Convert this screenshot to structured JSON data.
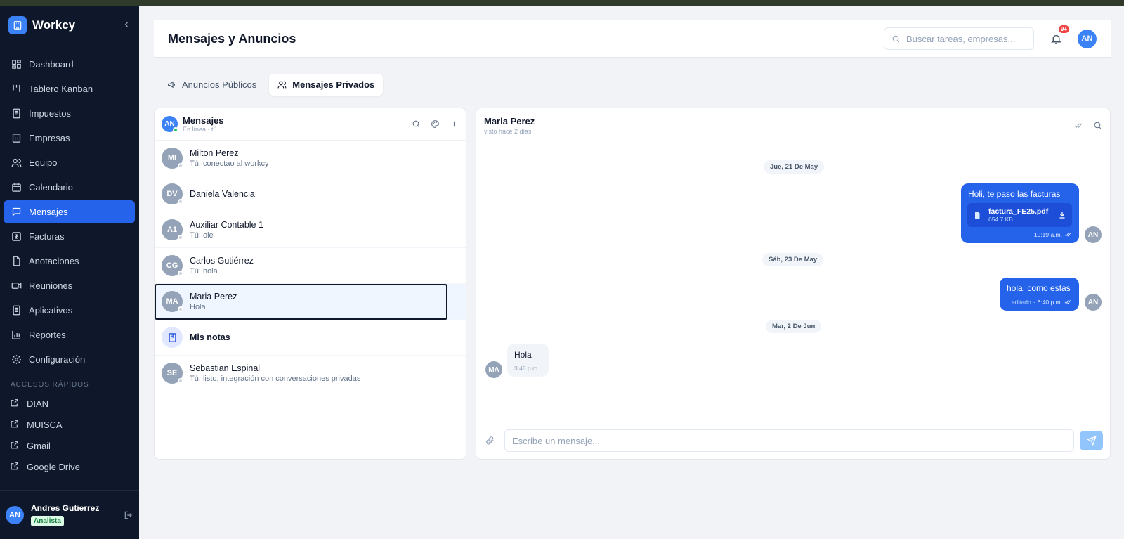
{
  "app": {
    "name": "Workcy"
  },
  "sidebar": {
    "items": [
      {
        "label": "Dashboard",
        "icon": "dashboard-icon"
      },
      {
        "label": "Tablero Kanban",
        "icon": "kanban-icon"
      },
      {
        "label": "Impuestos",
        "icon": "receipt-icon"
      },
      {
        "label": "Empresas",
        "icon": "building-icon"
      },
      {
        "label": "Equipo",
        "icon": "users-icon"
      },
      {
        "label": "Calendario",
        "icon": "calendar-icon"
      },
      {
        "label": "Mensajes",
        "icon": "message-icon",
        "active": true
      },
      {
        "label": "Facturas",
        "icon": "invoice-icon"
      },
      {
        "label": "Anotaciones",
        "icon": "file-icon"
      },
      {
        "label": "Reuniones",
        "icon": "video-icon"
      },
      {
        "label": "Aplicativos",
        "icon": "app-icon"
      },
      {
        "label": "Reportes",
        "icon": "chart-icon"
      },
      {
        "label": "Configuración",
        "icon": "gear-icon"
      }
    ],
    "quick_label": "ACCESOS RÁPIDOS",
    "quick_links": [
      "DIAN",
      "MUISCA",
      "Gmail",
      "Google Drive"
    ],
    "user": {
      "initials": "AN",
      "name": "Andres Gutierrez",
      "role": "Analista"
    }
  },
  "header": {
    "title": "Mensajes y Anuncios",
    "search_placeholder": "Buscar tareas, empresas...",
    "notif_badge": "9+",
    "avatar": "AN"
  },
  "tabs": [
    {
      "label": "Anuncios Públicos",
      "active": false
    },
    {
      "label": "Mensajes Privados",
      "active": true
    }
  ],
  "list": {
    "avatar": "AN",
    "title": "Mensajes",
    "status": "En línea · tú",
    "conversations": [
      {
        "initials": "MI",
        "name": "Milton Perez",
        "last": "Tú: conectao al workcy"
      },
      {
        "initials": "DV",
        "name": "Daniela Valencia",
        "last": ""
      },
      {
        "initials": "A1",
        "name": "Auxiliar Contable 1",
        "last": "Tú: ole"
      },
      {
        "initials": "CG",
        "name": "Carlos Gutiérrez",
        "last": "Tú: hola"
      },
      {
        "initials": "MA",
        "name": "Maria Perez",
        "last": "Hola",
        "selected": true
      },
      {
        "initials": "",
        "name": "Mis notas",
        "last": "",
        "notes": true
      },
      {
        "initials": "SE",
        "name": "Sebastian Espinal",
        "last": "Tú: listo, integración con conversaciones privadas"
      }
    ]
  },
  "chat": {
    "name": "Maria Perez",
    "seen": "visto hace 2 días",
    "dates": [
      "Jue, 21 De May",
      "Sáb, 23 De May",
      "Mar, 2 De Jun"
    ],
    "msg1": {
      "text": "Holi, te paso las facturas",
      "file": "factura_FE25.pdf",
      "size": "654.7 KB",
      "time": "10:19 a.m.",
      "avatar": "AN"
    },
    "msg2": {
      "text": "hola, como estas",
      "edited": "editado",
      "time": "6:40 p.m.",
      "avatar": "AN"
    },
    "msg3": {
      "text": "Hola",
      "time": "3:48 p.m.",
      "avatar": "MA"
    },
    "input_placeholder": "Escribe un mensaje..."
  },
  "colors": {
    "primary": "#2563eb",
    "sidebar": "#0f172a",
    "badge": "#ef4444",
    "online": "#22c55e"
  }
}
